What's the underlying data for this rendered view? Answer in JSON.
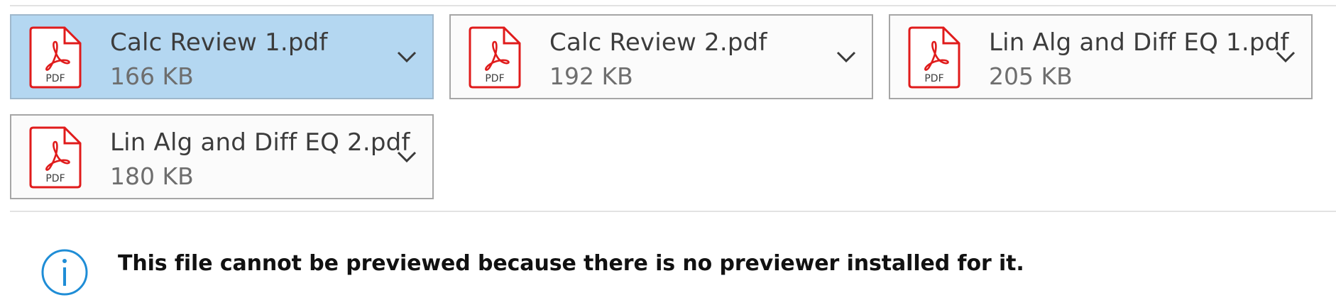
{
  "attachments": [
    {
      "name": "Calc Review 1.pdf",
      "size": "166 KB",
      "type_label": "PDF",
      "selected": true
    },
    {
      "name": "Calc Review 2.pdf",
      "size": "192 KB",
      "type_label": "PDF",
      "selected": false
    },
    {
      "name": "Lin Alg and Diff EQ 1.pdf",
      "size": "205 KB",
      "type_label": "PDF",
      "selected": false
    },
    {
      "name": "Lin Alg and Diff EQ 2.pdf",
      "size": "180 KB",
      "type_label": "PDF",
      "selected": false
    }
  ],
  "preview": {
    "message": "This file cannot be previewed because there is no previewer installed for it.",
    "icon": "info-icon"
  },
  "colors": {
    "selected_bg": "#b4d7f1",
    "pdf_red": "#e01b1b",
    "info_blue": "#1f8dd6"
  }
}
